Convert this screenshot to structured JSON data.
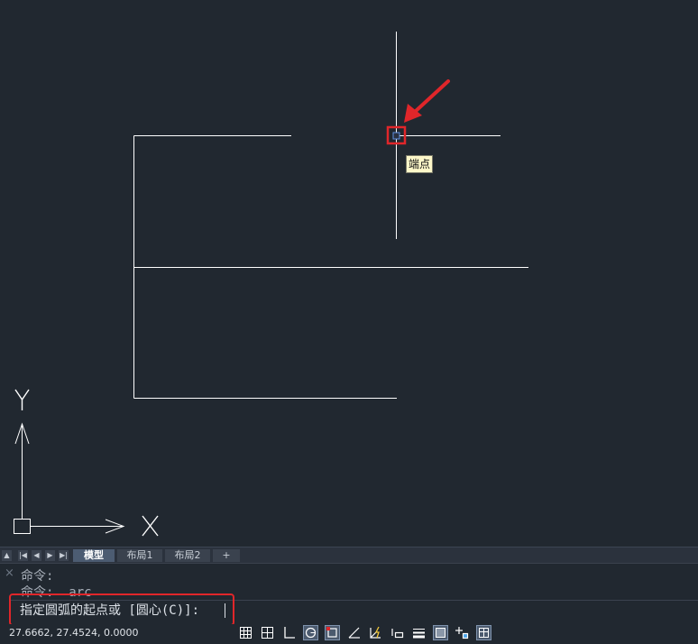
{
  "canvas": {
    "snap_tooltip": "端点",
    "ucs_y_label": "Y",
    "ucs_x_label": "X",
    "colors": {
      "background": "#212830",
      "geometry": "#ffffff",
      "highlight": "#e0262a"
    }
  },
  "layout_tabs": {
    "nav_icons": [
      "triangle-up-icon",
      "first-tab-icon",
      "prev-tab-icon",
      "next-tab-icon",
      "last-tab-icon"
    ],
    "tabs": [
      {
        "label": "模型",
        "active": true
      },
      {
        "label": "布局1",
        "active": false
      },
      {
        "label": "布局2",
        "active": false
      }
    ],
    "add_label": "+"
  },
  "command": {
    "close_icon": "×",
    "history": [
      "命令:",
      "命令: _arc"
    ],
    "prompt": "指定圆弧的起点或 [圆心(C)]:"
  },
  "status_bar": {
    "coordinates": "27.6662, 27.4524, 0.0000",
    "toggles": [
      {
        "name": "grid-display-icon",
        "on": false
      },
      {
        "name": "snap-mode-icon",
        "on": false
      },
      {
        "name": "ortho-mode-icon",
        "on": false
      },
      {
        "name": "polar-tracking-icon",
        "on": true
      },
      {
        "name": "object-snap-icon",
        "on": true
      },
      {
        "name": "snap-tracking-icon",
        "on": false
      },
      {
        "name": "dynamic-ucs-icon",
        "on": false
      },
      {
        "name": "dynamic-input-icon",
        "on": false
      },
      {
        "name": "lineweight-icon",
        "on": false
      },
      {
        "name": "transparency-icon",
        "on": true
      },
      {
        "name": "selection-cycling-icon",
        "on": false
      },
      {
        "name": "annotation-monitor-icon",
        "on": true
      }
    ]
  }
}
